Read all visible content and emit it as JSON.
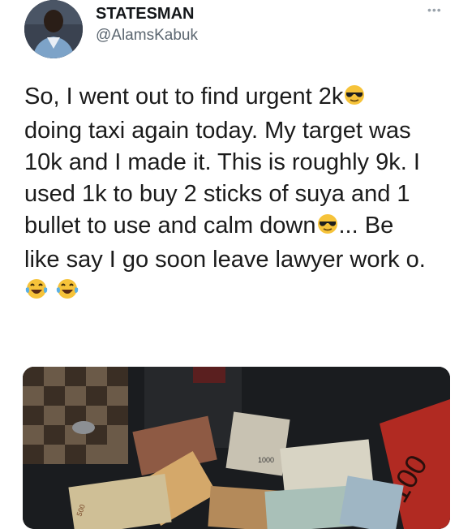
{
  "author": {
    "name": "STATESMAN",
    "handle": "@AlamsKabuk"
  },
  "more_label": "•••",
  "tweet": {
    "line1": "So, I went out to find urgent 2k",
    "line2": "doing taxi again today. My target was",
    "line3": "10k and I made it. This is roughly 9k. I",
    "line4": "used 1k to buy 2 sticks of suya and 1",
    "line5a": "bullet to use and calm down",
    "line5b": "... Be",
    "line6": "like say I go soon leave lawyer work o."
  },
  "media": {
    "note_label_a": "1000",
    "note_label_b": "500"
  },
  "icons": {
    "emoji_cool": "sunglasses-face-icon",
    "emoji_laugh": "tears-of-joy-icon"
  }
}
